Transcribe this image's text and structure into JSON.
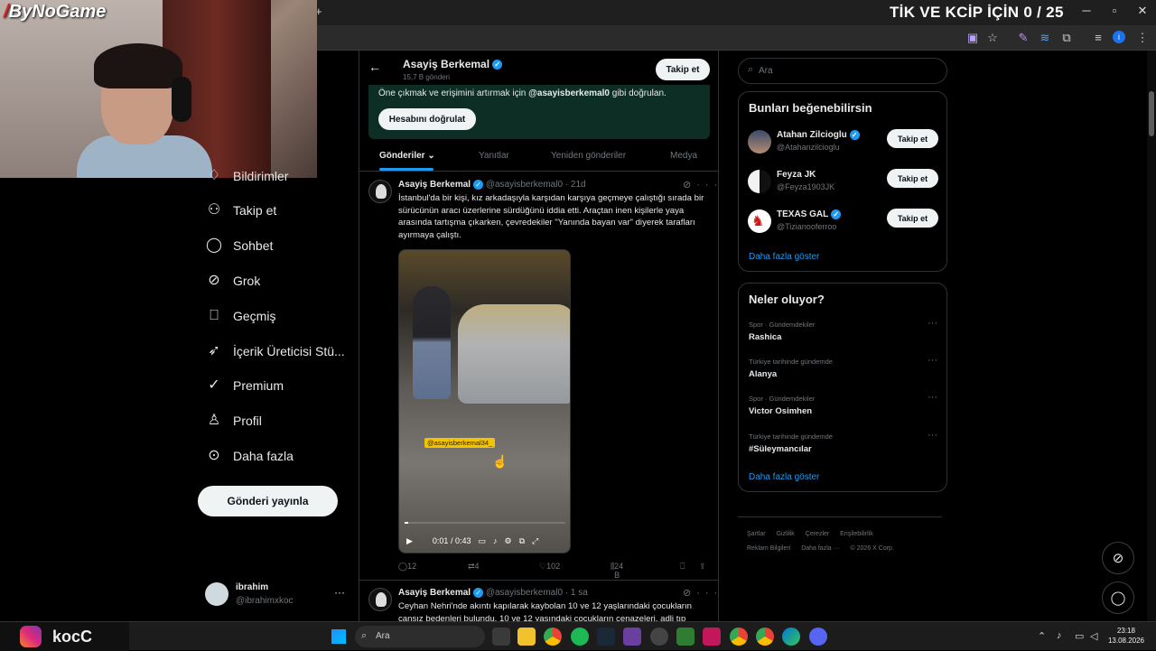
{
  "overlay": {
    "title": "TİK VE KCİP İÇİN 0 / 25",
    "logo_prefix": "/",
    "logo": "ByNoGame"
  },
  "browser": {
    "new_tab": "+",
    "win_min": "─",
    "win_max": "▫",
    "win_close": "✕"
  },
  "nav": {
    "items": [
      {
        "label": "Bildirimler",
        "icon": "bell-icon"
      },
      {
        "label": "Takip et",
        "icon": "person-add-icon"
      },
      {
        "label": "Sohbet",
        "icon": "chat-icon"
      },
      {
        "label": "Grok",
        "icon": "grok-icon"
      },
      {
        "label": "Geçmiş",
        "icon": "bookmark-icon"
      },
      {
        "label": "İçerik Üreticisi Stü...",
        "icon": "rocket-icon"
      },
      {
        "label": "Premium",
        "icon": "verified-icon"
      },
      {
        "label": "Profil",
        "icon": "person-icon"
      },
      {
        "label": "Daha fazla",
        "icon": "more-circle-icon"
      }
    ],
    "post_button": "Gönderi yayınla",
    "account": {
      "name": "ibrahim",
      "handle": "@ibrahimxkoc",
      "more": "···"
    }
  },
  "profile": {
    "back": "←",
    "name": "Asayiş Berkemal",
    "post_count": "15,7 B gönderi",
    "follow_button": "Takip et",
    "verify_text_prefix": "Öne çıkmak ve erişimini artırmak için ",
    "verify_handle": "@asayisberkemal0",
    "verify_text_suffix": " gibi doğrulan.",
    "verify_button": "Hesabını doğrulat",
    "tabs": [
      "Gönderiler",
      "Yanıtlar",
      "Yeniden gönderiler",
      "Medya"
    ],
    "tab_chevron": "⌄"
  },
  "tweets": [
    {
      "name": "Asayiş Berkemal",
      "handle": "@asayisberkemal0 · 21d",
      "text": "İstanbul'da bir kişi, kız arkadaşıyla karşıdan karşıya geçmeye çalıştığı sırada bir sürücünün aracı üzerlerine sürdüğünü iddia etti. Araçtan inen kişilerle yaya arasında tartışma çıkarken, çevredekiler \"Yanında bayan var\" diyerek tarafları ayırmaya çalıştı.",
      "video": {
        "watermark": "@asayisberkemal34_",
        "time": "0:01 / 0:43",
        "progress": 0.023
      },
      "replies": "12",
      "reposts": "4",
      "likes": "102",
      "views": "24 B"
    },
    {
      "name": "Asayiş Berkemal",
      "handle": "@asayisberkemal0 · 1 sa",
      "text": "Ceyhan Nehri'nde akıntı kapılarak kaybolan 10 ve 12 yaşlarındaki çocukların cansız bedenleri bulundu. 10 ve 12 yaşındaki çocukların cenazeleri, adli tıp"
    }
  ],
  "search": {
    "placeholder": "Ara"
  },
  "who_to_follow": {
    "title": "Bunları beğenebilirsin",
    "users": [
      {
        "name": "Atahan Zilcioglu",
        "handle": "@Atahanzilcioglu",
        "button": "Takip et",
        "verified": true
      },
      {
        "name": "Feyza JK",
        "handle": "@Feyza1903JK",
        "button": "Takip et",
        "verified": false
      },
      {
        "name": "TEXAS GAL",
        "handle": "@Tizianooferroo",
        "button": "Takip et",
        "verified": true
      }
    ],
    "show_more": "Daha fazla göster"
  },
  "trends": {
    "title": "Neler oluyor?",
    "items": [
      {
        "category": "Spor · Gündemdekiler",
        "title": "Rashica"
      },
      {
        "category": "Türkiye tarihinde gündemde",
        "title": "Alanya"
      },
      {
        "category": "Spor · Gündemdekiler",
        "title": "Victor Osimhen"
      },
      {
        "category": "Türkiye tarihinde gündemde",
        "title": "#Süleymancılar"
      }
    ],
    "show_more": "Daha fazla göster"
  },
  "footer": {
    "row1": [
      "Şartlar",
      "Gizlilik",
      "Çerezler",
      "Erişilebilirlik"
    ],
    "row2": [
      "Reklam Bilgileri",
      "Daha fazla ···",
      "© 2026 X Corp."
    ]
  },
  "taskbar": {
    "overlay_text": "kocC",
    "search_placeholder": "Ara",
    "time": "23:18",
    "date": "13.08.2026"
  },
  "colors": {
    "accent": "#1d9bf0",
    "banner": "#0d2e25",
    "background": "#000000"
  }
}
